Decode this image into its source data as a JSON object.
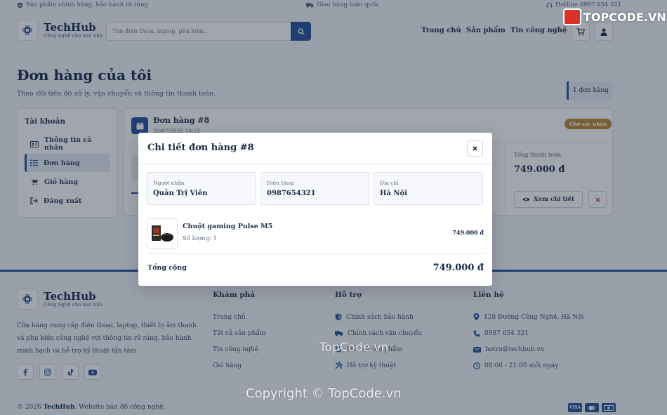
{
  "topbar": {
    "authentic": "Sản phẩm chính hãng, bảo hành rõ ràng",
    "shipping": "Giao hàng toàn quốc",
    "hotline": "Hotline 0987 654 321"
  },
  "header": {
    "brand": "TechHub",
    "tagline": "Công nghệ cho mọi nhà",
    "search_placeholder": "Tìm điện thoại, laptop, phụ kiện...",
    "nav": [
      "Trang chủ",
      "Sản phẩm",
      "Tin công nghệ"
    ]
  },
  "page": {
    "title": "Đơn hàng của tôi",
    "subtitle": "Theo dõi tiến độ xử lý, vận chuyển và thông tin thanh toán.",
    "order_count": "1 đơn hàng"
  },
  "sidebar": {
    "heading": "Tài khoản",
    "items": [
      {
        "label": "Thông tin cá nhân",
        "icon": "id-card-icon"
      },
      {
        "label": "Đơn hàng",
        "icon": "list-icon",
        "active": true
      },
      {
        "label": "Giỏ hàng",
        "icon": "cart-icon"
      },
      {
        "label": "Đăng xuất",
        "icon": "logout-icon"
      }
    ]
  },
  "order": {
    "title": "Đơn hàng #8",
    "date": "29/07/2026 14:51",
    "status": "Chờ xác nhận",
    "total_label": "Tổng thanh toán",
    "total": "749.000 đ",
    "view_label": "Xem chi tiết"
  },
  "modal": {
    "title": "Chi tiết đơn hàng #8",
    "recipient_label": "Người nhận",
    "recipient": "Quản Trị Viên",
    "phone_label": "Điện thoại",
    "phone": "0987654321",
    "address_label": "Địa chỉ",
    "address": "Hà Nội",
    "item_name": "Chuột gaming Pulse M5",
    "item_qty": "Số lượng: 1",
    "item_price": "749.000 đ",
    "total_label": "Tổng cộng",
    "total": "749.000 đ"
  },
  "footer": {
    "brand": "TechHub",
    "tagline": "Công nghệ cho mọi nhà",
    "description": "Cửa hàng cung cấp điện thoại, laptop, thiết bị âm thanh và phụ kiện công nghệ với thông tin rõ ràng, bảo hành minh bạch và hỗ trợ kỹ thuật tận tâm.",
    "explore_heading": "Khám phá",
    "explore": [
      "Trang chủ",
      "Tất cả sản phẩm",
      "Tin công nghệ",
      "Giỏ hàng"
    ],
    "support_heading": "Hỗ trợ",
    "support": [
      "Chính sách bảo hành",
      "Chính sách vận chuyển",
      "Đổi trả sản phẩm",
      "Hỗ trợ kỹ thuật"
    ],
    "contact_heading": "Liên hệ",
    "contact": [
      "128 Đường Công Nghệ, Hà Nội",
      "0987 654 321",
      "hotro@techhub.vn",
      "08:00 - 21:00 mỗi ngày"
    ],
    "copyright_prefix": "© 2026",
    "copyright_brand": "TechHub",
    "copyright_suffix": ". Website bán đồ công nghệ.",
    "pay_visa": "VISA"
  },
  "watermarks": {
    "logo": "TOPCODE.VN",
    "mid": "TopCode.vn",
    "bottom": "Copyright © TopCode.vn"
  },
  "colors": {
    "primary": "#1f4f96",
    "status": "#b8862b",
    "danger": "#c0392b"
  }
}
